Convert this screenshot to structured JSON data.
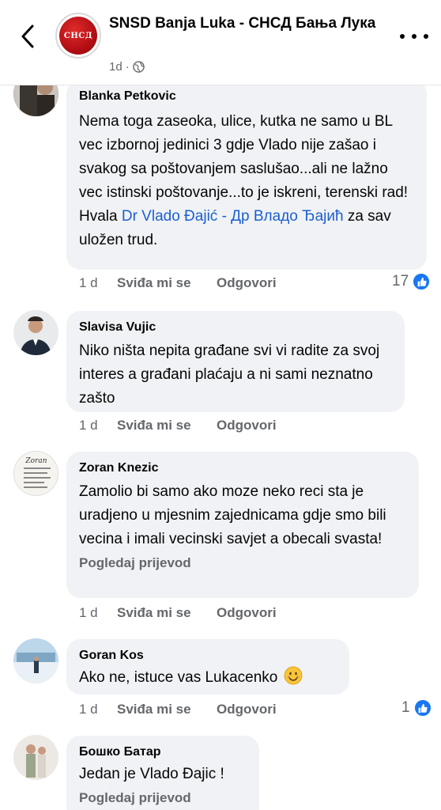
{
  "header": {
    "title": "SNSD Banja Luka - СНСД Бања Лука",
    "avatar_text": "СНСД",
    "time": "1d",
    "separator": "·"
  },
  "comments": [
    {
      "author": "Blanka Petkovic",
      "text_before": "Nema toga zaseoka, ulice, kutka ne samo u BL vec izbornoj jedinici 3 gdje Vlado nije zašao i svakog sa poštovanjem saslušao...ali ne lažno  vec istinski poštovanje...to je iskreni, terenski rad! Hvala ",
      "mention": "Dr Vlado Đajić - Др Владо Ђајић",
      "text_after": " za sav uložen trud.",
      "time": "1 d",
      "like_label": "Sviđa mi se",
      "reply_label": "Odgovori",
      "reactions": "17"
    },
    {
      "author": "Slavisa Vujic",
      "text": "Niko ništa nepita građane svi vi radite za svoj interes a građani plaćaju a ni sami neznatno zašto",
      "time": "1 d",
      "like_label": "Sviđa mi se",
      "reply_label": "Odgovori"
    },
    {
      "author": "Zoran Knezic",
      "text": "Zamolio bi samo ako moze neko reci sta je uradjeno u mjesnim zajednicama gdje smo bili vecina i imali vecinski savjet a obecali svasta!",
      "translate": "Pogledaj prijevod",
      "time": "1 d",
      "like_label": "Sviđa mi se",
      "reply_label": "Odgovori"
    },
    {
      "author": "Goran Kos",
      "text": "Ako ne, istuce vas Lukacenko",
      "time": "1 d",
      "like_label": "Sviđa mi se",
      "reply_label": "Odgovori",
      "reactions": "1"
    },
    {
      "author": "Бошко Батар",
      "text": "Jedan je Vlado Đajic !",
      "translate": "Pogledaj prijevod"
    }
  ],
  "colors": {
    "bubble": "#f0f2f5",
    "secondary_text": "#65676b",
    "link": "#1b5fd1",
    "like_blue": "#1877f2"
  }
}
